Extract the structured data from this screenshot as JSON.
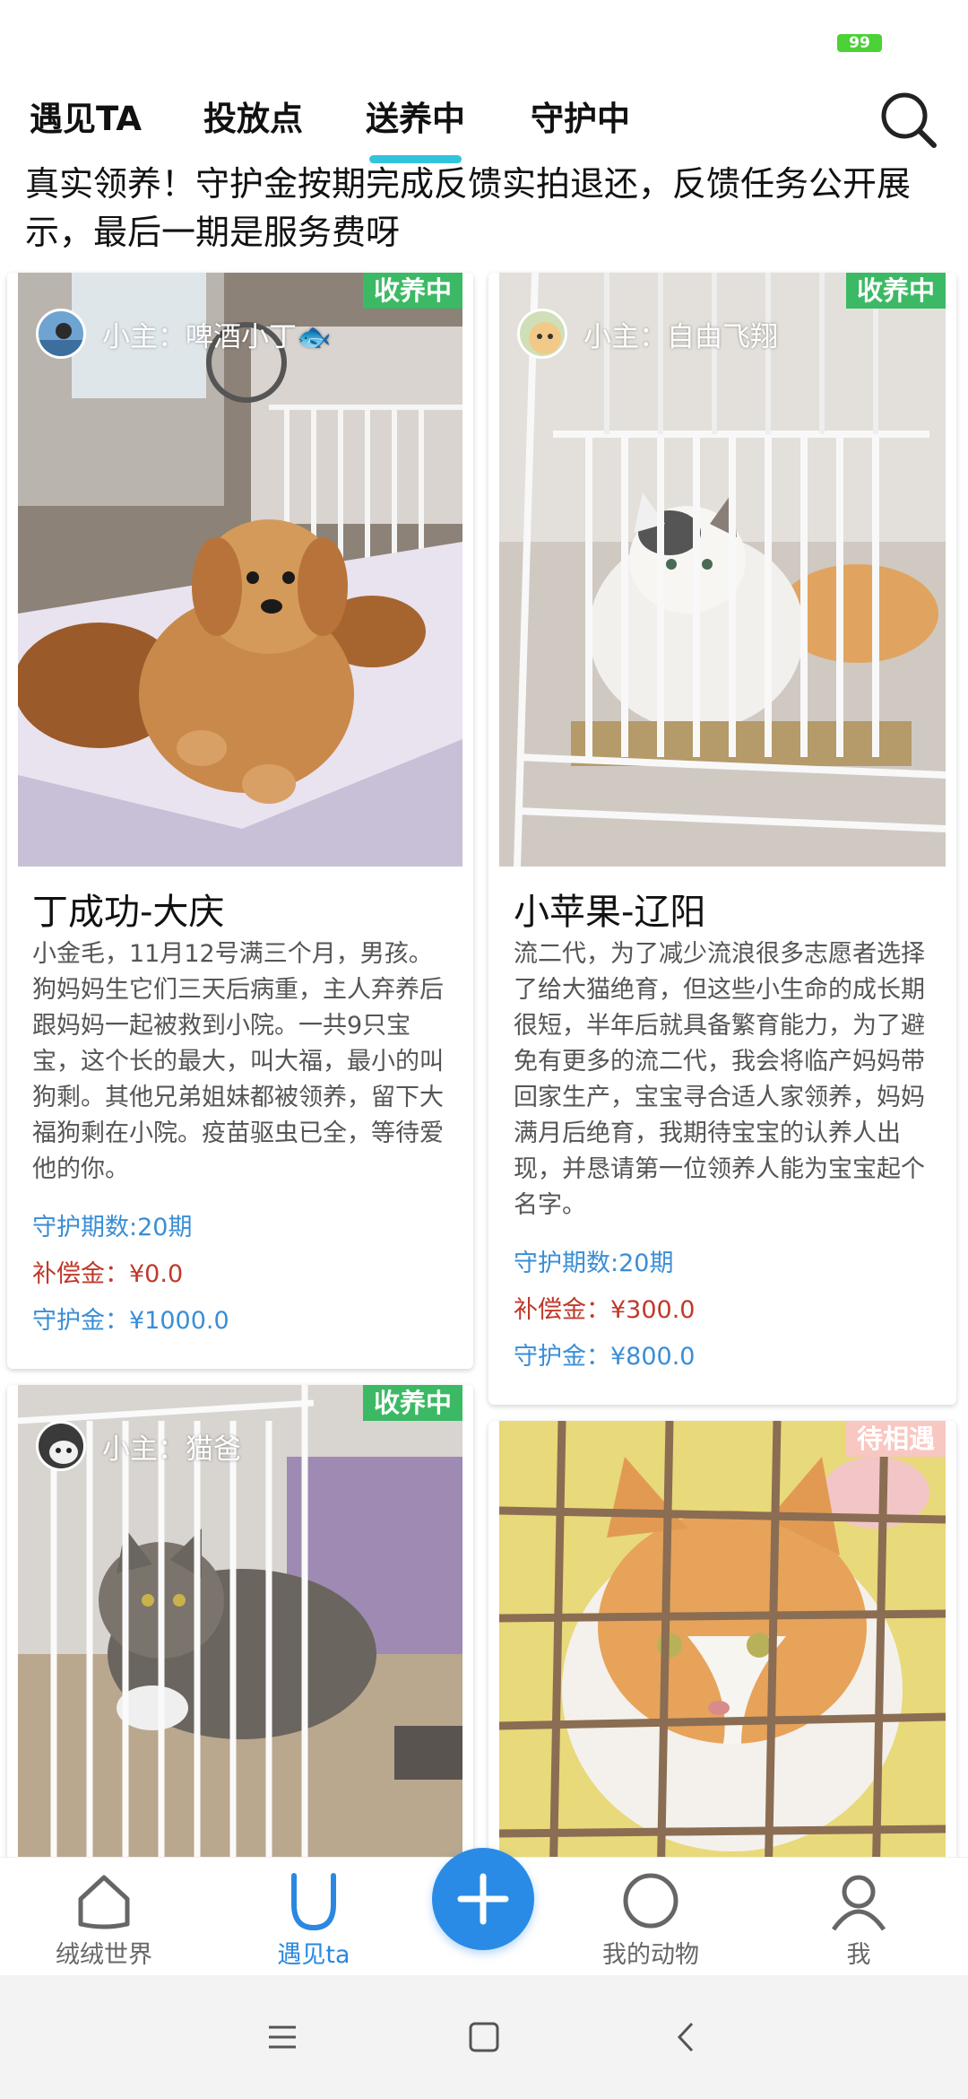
{
  "status": {
    "battery": "99"
  },
  "tabs": [
    {
      "label": "遇见TA"
    },
    {
      "label": "投放点"
    },
    {
      "label": "送养中"
    },
    {
      "label": "守护中"
    }
  ],
  "notice": "真实领养！守护金按期完成反馈实拍退还，反馈任务公开展示，最后一期是服务费呀",
  "cards": [
    {
      "badge": "收养中",
      "owner": "小主：啤酒小丁🐟",
      "title": "丁成功-大庆",
      "desc": "小金毛，11月12号满三个月，男孩。狗妈妈生它们三天后病重，主人弃养后跟妈妈一起被救到小院。一共9只宝宝，这个长的最大，叫大福，最小的叫狗剩。其他兄弟姐妹都被领养，留下大福狗剩在小院。疫苗驱虫已全，等待爱他的你。",
      "period": "守护期数:20期",
      "compensation": "补偿金：¥0.0",
      "guard_fee": "守护金：¥1000.0"
    },
    {
      "badge": "收养中",
      "owner": "小主：自由飞翔",
      "title": "小苹果-辽阳",
      "desc": "流二代，为了减少流浪很多志愿者选择了给大猫绝育，但这些小生命的成长期很短，半年后就具备繁育能力，为了避免有更多的流二代，我会将临产妈妈带回家生产，宝宝寻合适人家领养，妈妈满月后绝育，我期待宝宝的认养人出现，并恳请第一位领养人能为宝宝起个名字。",
      "period": "守护期数:20期",
      "compensation": "补偿金：¥300.0",
      "guard_fee": "守护金：¥800.0"
    },
    {
      "badge": "收养中",
      "owner": "小主：猫爸"
    },
    {
      "badge": "待相遇"
    }
  ],
  "bottom_nav": [
    {
      "label": "绒绒世界",
      "icon": "house-icon"
    },
    {
      "label": "遇见ta",
      "icon": "meet-icon"
    },
    {
      "label": "我的动物",
      "icon": "circle-icon"
    },
    {
      "label": "我",
      "icon": "person-icon"
    }
  ],
  "colors": {
    "accent": "#32c4dc",
    "primary": "#2a8be6",
    "badge_green": "#3cb964",
    "badge_pink": "#f9c7c1",
    "money_red": "#c0392b",
    "link_blue": "#3a8ed6"
  }
}
